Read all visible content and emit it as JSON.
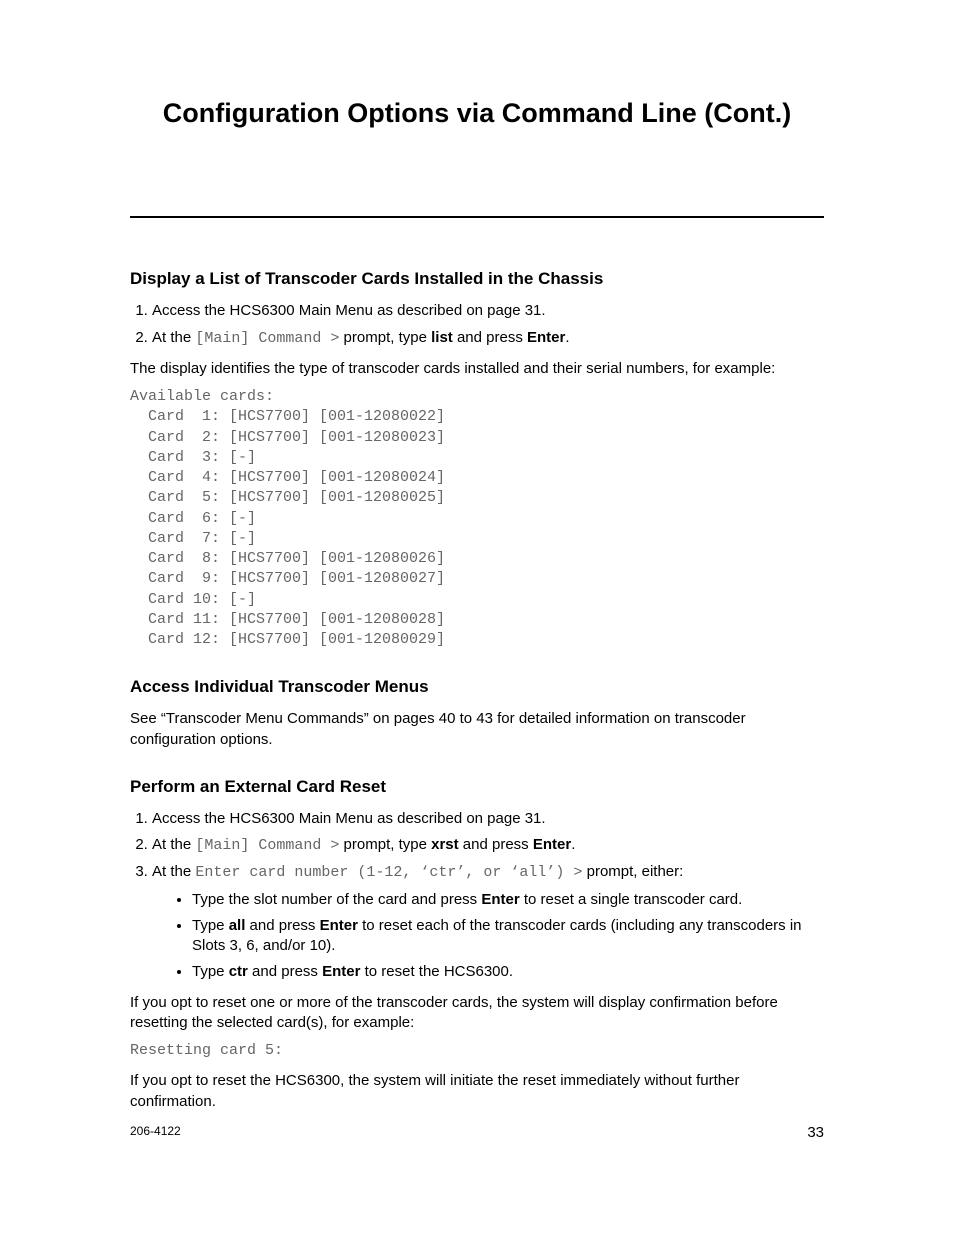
{
  "title": "Configuration Options via Command Line (Cont.)",
  "sec_display": {
    "heading": "Display a List of Transcoder Cards Installed in the Chassis",
    "step1": "Access the HCS6300 Main Menu as described on page 31.",
    "step2_a": "At the ",
    "step2_prompt": "[Main] Command >",
    "step2_b": " prompt, type ",
    "step2_cmd": "list",
    "step2_c": " and press ",
    "step2_enter": "Enter",
    "step2_d": ".",
    "after": "The display identifies the type of transcoder cards installed and their serial numbers, for example:",
    "term": "Available cards:\n  Card  1: [HCS7700] [001-12080022]\n  Card  2: [HCS7700] [001-12080023]\n  Card  3: [-]\n  Card  4: [HCS7700] [001-12080024]\n  Card  5: [HCS7700] [001-12080025]\n  Card  6: [-]\n  Card  7: [-]\n  Card  8: [HCS7700] [001-12080026]\n  Card  9: [HCS7700] [001-12080027]\n  Card 10: [-]\n  Card 11: [HCS7700] [001-12080028]\n  Card 12: [HCS7700] [001-12080029]"
  },
  "sec_access": {
    "heading": "Access Individual Transcoder Menus",
    "body": "See “Transcoder Menu Commands” on pages 40 to 43 for detailed information on transcoder configuration options."
  },
  "sec_reset": {
    "heading": "Perform an External Card Reset",
    "step1": "Access the HCS6300 Main Menu as described on page 31.",
    "step2_a": "At the ",
    "step2_prompt": "[Main] Command >",
    "step2_b": " prompt, type ",
    "step2_cmd": "xrst",
    "step2_c": " and press ",
    "step2_enter": "Enter",
    "step2_d": ".",
    "step3_a": "At the ",
    "step3_prompt": "Enter card number (1-12, ‘ctr’, or ‘all’) >",
    "step3_b": " prompt, either:",
    "sub1_a": "Type the slot number of the card and press ",
    "sub1_enter": "Enter",
    "sub1_b": " to reset a single transcoder card.",
    "sub2_a": "Type ",
    "sub2_cmd": "all",
    "sub2_b": " and press ",
    "sub2_enter": "Enter",
    "sub2_c": " to reset each of the transcoder cards (including any transcoders in Slots 3, 6, and/or 10).",
    "sub3_a": "Type ",
    "sub3_cmd": "ctr",
    "sub3_b": " and press ",
    "sub3_enter": "Enter",
    "sub3_c": " to reset the HCS6300.",
    "confirm": "If you opt to reset one or more of the transcoder cards, the system will display confirmation before resetting the selected card(s), for example:",
    "term": "Resetting card 5:",
    "final": "If you opt to reset the HCS6300, the system will initiate the reset immediately without further confirmation."
  },
  "footer": {
    "docnum": "206-4122",
    "pagenum": "33"
  }
}
